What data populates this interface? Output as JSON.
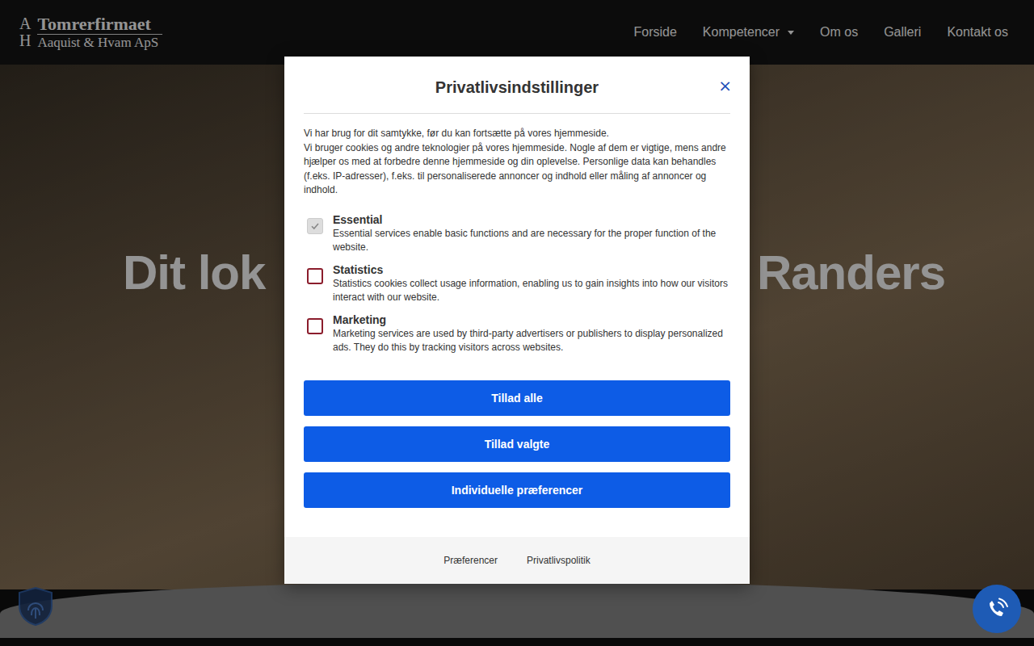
{
  "header": {
    "logo": {
      "initials": [
        "A",
        "H"
      ],
      "name": "Tomrerfirmaet",
      "company": "Aaquist & Hvam ApS"
    },
    "nav": [
      {
        "label": "Forside",
        "hasDropdown": false
      },
      {
        "label": "Kompetencer",
        "hasDropdown": true
      },
      {
        "label": "Om os",
        "hasDropdown": false
      },
      {
        "label": "Galleri",
        "hasDropdown": false
      },
      {
        "label": "Kontakt os",
        "hasDropdown": false
      }
    ]
  },
  "hero": {
    "heading_left": "Dit lok",
    "heading_right": "Randers"
  },
  "consent": {
    "title": "Privatlivsindstillinger",
    "close": "×",
    "intro": [
      "Vi har brug for dit samtykke, før du kan fortsætte på vores hjemmeside.",
      "Vi bruger cookies og andre teknologier på vores hjemmeside. Nogle af dem er vigtige, mens andre hjælper os med at forbedre denne hjemmeside og din oplevelse. Personlige data kan behandles (f.eks. IP-adresser), f.eks. til personaliserede annoncer og indhold eller måling af annoncer og indhold."
    ],
    "categories": [
      {
        "name": "Essential",
        "description": "Essential services enable basic functions and are necessary for the proper function of the website.",
        "checked": true,
        "disabled": true
      },
      {
        "name": "Statistics",
        "description": "Statistics cookies collect usage information, enabling us to gain insights into how our visitors interact with our website.",
        "checked": false,
        "disabled": false
      },
      {
        "name": "Marketing",
        "description": "Marketing services are used by third-party advertisers or publishers to display personalized ads. They do this by tracking visitors across websites.",
        "checked": false,
        "disabled": false
      }
    ],
    "buttons": [
      "Tillad alle",
      "Tillad valgte",
      "Individuelle præferencer"
    ],
    "footer_links": [
      "Præferencer",
      "Privatlivspolitik"
    ]
  }
}
